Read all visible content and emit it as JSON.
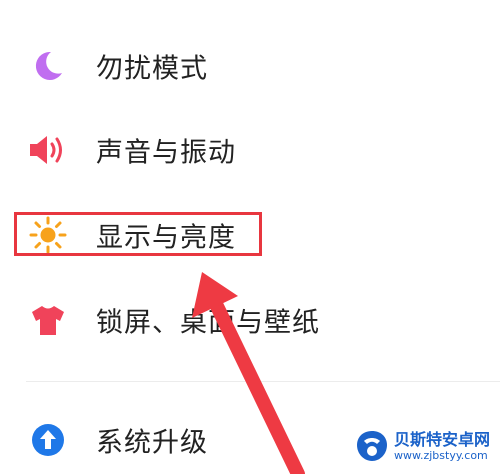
{
  "settings": {
    "items": [
      {
        "label": "勿扰模式",
        "icon": "moon-icon",
        "color": "#c06ef0"
      },
      {
        "label": "声音与振动",
        "icon": "speaker-icon",
        "color": "#f0435a"
      },
      {
        "label": "显示与亮度",
        "icon": "sun-icon",
        "color": "#f7a21b"
      },
      {
        "label": "锁屏、桌面与壁纸",
        "icon": "tshirt-icon",
        "color": "#f0435a"
      },
      {
        "label": "系统升级",
        "icon": "arrow-up-circle-icon",
        "color": "#1f78e8"
      }
    ]
  },
  "annotation": {
    "highlight_color": "#e8363f",
    "highlighted_item": "显示与亮度"
  },
  "watermark": {
    "title": "贝斯特安卓网",
    "url": "www.zjbstyy.com",
    "color": "#1b62c9"
  }
}
